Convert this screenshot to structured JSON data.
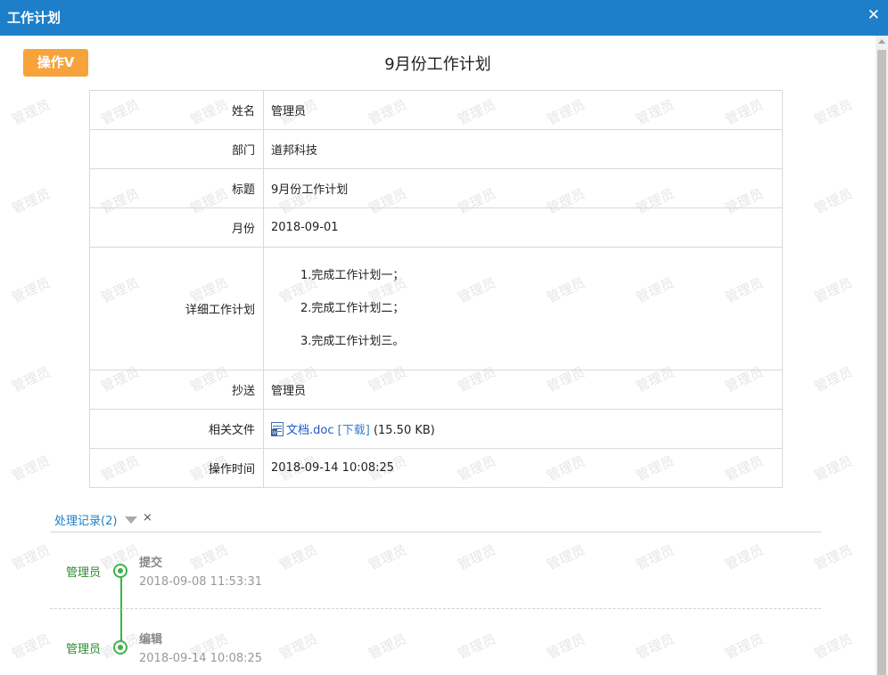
{
  "window": {
    "title": "工作计划",
    "close_icon": "close-icon"
  },
  "toolbar": {
    "op_button": "操作V"
  },
  "page": {
    "title": "9月份工作计划"
  },
  "watermark_text": "管理员",
  "fields": {
    "name_label": "姓名",
    "name_value": "管理员",
    "dept_label": "部门",
    "dept_value": "道邦科技",
    "title_label": "标题",
    "title_value": "9月份工作计划",
    "month_label": "月份",
    "month_value": "2018-09-01",
    "plan_label": "详细工作计划",
    "plan_lines": [
      "1.完成工作计划一；",
      "2.完成工作计划二；",
      "3.完成工作计划三。"
    ],
    "cc_label": "抄送",
    "cc_value": "管理员",
    "file_label": "相关文件",
    "file_name": "文档.doc",
    "file_download": "[下载]",
    "file_size": "(15.50 KB)",
    "time_label": "操作时间",
    "time_value": "2018-09-14 10:08:25"
  },
  "records": {
    "header": "处理记录(2)",
    "close_glyph": "×",
    "items": [
      {
        "user": "管理员",
        "action": "提交",
        "time": "2018-09-08 11:53:31"
      },
      {
        "user": "管理员",
        "action": "编辑",
        "time": "2018-09-14 10:08:25"
      }
    ]
  },
  "colors": {
    "titlebar": "#1d7fc9",
    "op_button": "#f7a33c",
    "timeline": "#3cb34a"
  }
}
